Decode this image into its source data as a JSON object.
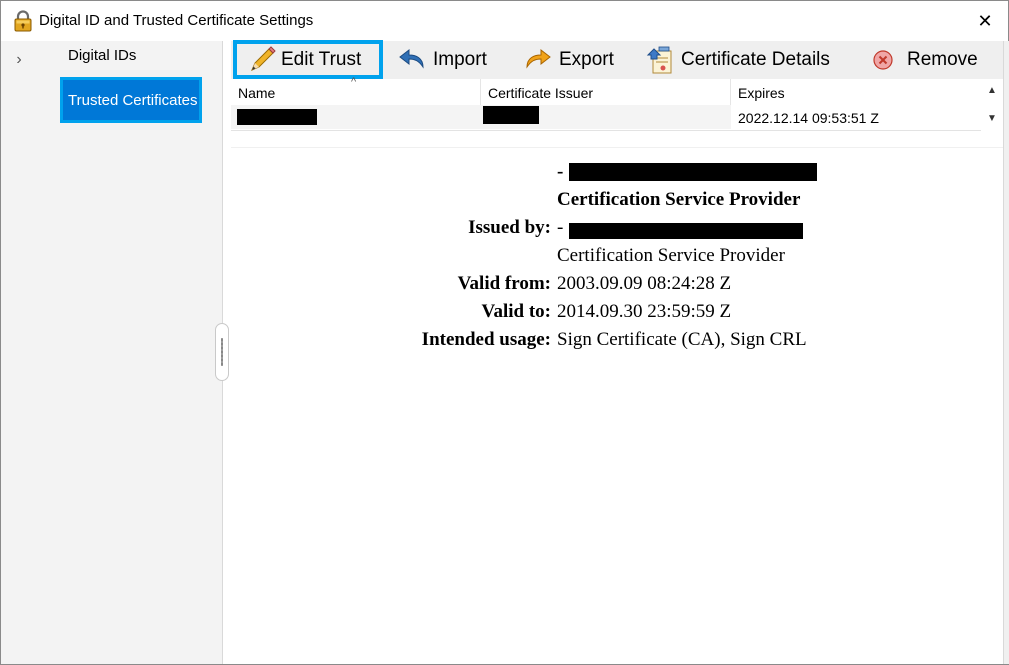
{
  "window": {
    "title": "Digital ID and Trusted Certificate Settings",
    "close_glyph": "✕",
    "icons": {
      "title": "padlock-icon",
      "close": "close-icon"
    }
  },
  "sidebar": {
    "expand_glyph": "›",
    "items": [
      {
        "label": "Digital IDs",
        "selected": false
      },
      {
        "label": "Trusted Certificates",
        "selected": true
      }
    ]
  },
  "toolbar": {
    "edit_trust": "Edit Trust",
    "import": "Import",
    "export": "Export",
    "certificate_details": "Certificate Details",
    "remove": "Remove",
    "icons": {
      "edit_trust": "pencil-icon",
      "import": "import-arrow-icon",
      "export": "export-arrow-icon",
      "certificate_details": "certificate-icon",
      "remove": "remove-icon"
    }
  },
  "table": {
    "columns": [
      "Name",
      "Certificate Issuer",
      "Expires"
    ],
    "sort_glyph": "^",
    "rows": [
      {
        "name": "",
        "issuer": "",
        "expires": "2022.12.14 09:53:51 Z"
      }
    ],
    "scroll_up": "▲",
    "scroll_down": "▼"
  },
  "details": {
    "subject_dash": "-",
    "subject_provider": "Certification Service Provider",
    "issued_by_label": "Issued by:",
    "issued_by_dash": "-",
    "issued_by_provider": "Certification Service Provider",
    "valid_from_label": "Valid from:",
    "valid_from": "2003.09.09 08:24:28 Z",
    "valid_to_label": "Valid to:",
    "valid_to": "2014.09.30 23:59:59 Z",
    "usage_label": "Intended usage:",
    "usage": "Sign Certificate (CA), Sign CRL"
  },
  "colors": {
    "selection": "#0078d7",
    "focus_border": "#00a2ed",
    "toolbar_bg": "#efefef",
    "sidebar_bg": "#f3f3f3"
  }
}
